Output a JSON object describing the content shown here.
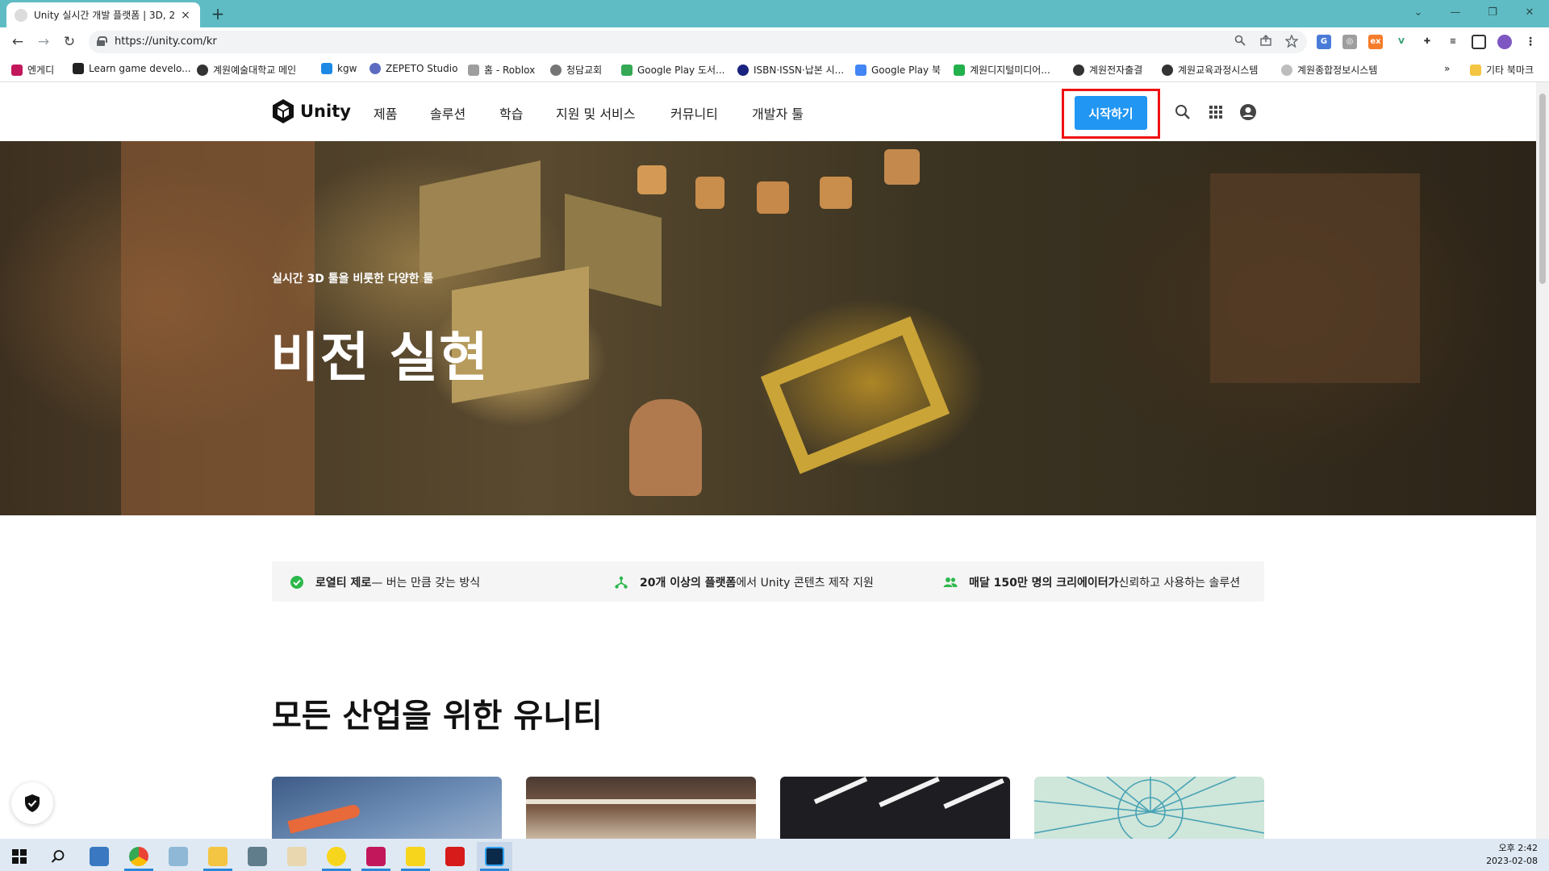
{
  "browser": {
    "tab_title": "Unity 실시간 개발 플랫폼 | 3D, 2",
    "tab_close": "×",
    "new_tab": "+",
    "url": "https://unity.com/kr",
    "back": "←",
    "forward": "→",
    "reload": "↻",
    "window_controls": [
      "⌄",
      "—",
      "❐",
      "✕"
    ]
  },
  "bookmarks": [
    {
      "label": "엔게디",
      "color": "#c2185b"
    },
    {
      "label": "Learn game develo...",
      "color": "#222222"
    },
    {
      "label": "계원예술대학교 메인",
      "color": "#333333"
    },
    {
      "label": "kgw",
      "color": "#1e88e5"
    },
    {
      "label": "ZEPETO Studio",
      "color": "#5c6bc0"
    },
    {
      "label": "홈 - Roblox",
      "color": "#9e9e9e"
    },
    {
      "label": "청담교회",
      "color": "#757575"
    },
    {
      "label": "Google Play 도서...",
      "color": "#34a853"
    },
    {
      "label": "ISBN·ISSN·납본 시...",
      "color": "#1a237e"
    },
    {
      "label": "Google Play 북",
      "color": "#4285f4"
    },
    {
      "label": "계원디지털미디어...",
      "color": "#22b14c"
    },
    {
      "label": "계원전자출결",
      "color": "#333333"
    },
    {
      "label": "계원교육과정시스템",
      "color": "#333333"
    },
    {
      "label": "계원종합정보시스템",
      "color": "#bdbdbd"
    }
  ],
  "bookmarks_more": "»",
  "bookmarks_other": "기타 북마크",
  "site": {
    "logo_text": "Unity",
    "nav": [
      "제품",
      "솔루션",
      "학습",
      "지원 및 서비스",
      "커뮤니티",
      "개발자 툴"
    ],
    "cta": "시작하기"
  },
  "hero": {
    "kicker": "실시간 3D 툴을 비롯한 다양한 툴",
    "title": "비전 실현"
  },
  "value_props": [
    {
      "bold": "로열티 제로",
      "rest": " — 버는 만큼 갖는 방식"
    },
    {
      "bold": "20개 이상의 플랫폼",
      "rest": "에서 Unity 콘텐츠 제작 지원"
    },
    {
      "bold": "매달 150만 명의 크리에이터가",
      "rest": " 신뢰하고 사용하는 솔루션"
    }
  ],
  "section_title": "모든 산업을 위한 유니티",
  "taskbar": {
    "time": "오후 2:42",
    "date": "2023-02-08"
  },
  "colors": {
    "tab_strip": "#5fbcc4",
    "cta_blue": "#2196f3",
    "highlight_red": "#ee1111",
    "check_green": "#2db84c"
  }
}
